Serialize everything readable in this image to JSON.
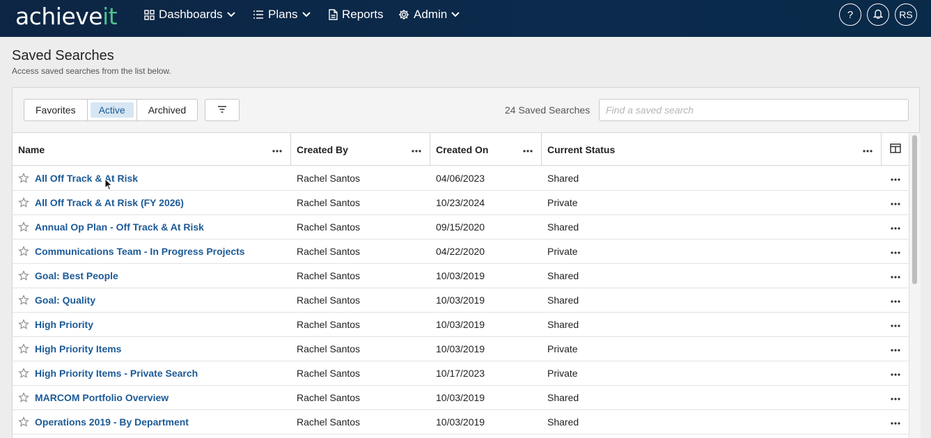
{
  "nav": {
    "logo_main": "achieve",
    "logo_accent": "it",
    "dashboards": "Dashboards",
    "plans": "Plans",
    "reports": "Reports",
    "admin": "Admin",
    "help": "?",
    "avatar_initials": "RS"
  },
  "header": {
    "title": "Saved Searches",
    "subtitle": "Access saved searches from the list below."
  },
  "toolbar": {
    "favorites": "Favorites",
    "active": "Active",
    "archived": "Archived",
    "count": "24 Saved Searches",
    "search_placeholder": "Find a saved search"
  },
  "columns": {
    "name": "Name",
    "created_by": "Created By",
    "created_on": "Created On",
    "status": "Current Status"
  },
  "rows": [
    {
      "name": "All Off Track & At Risk",
      "created_by": "Rachel Santos",
      "created_on": "04/06/2023",
      "status": "Shared"
    },
    {
      "name": "All Off Track & At Risk (FY 2026)",
      "created_by": "Rachel Santos",
      "created_on": "10/23/2024",
      "status": "Private"
    },
    {
      "name": "Annual Op Plan - Off Track & At Risk",
      "created_by": "Rachel Santos",
      "created_on": "09/15/2020",
      "status": "Shared"
    },
    {
      "name": "Communications Team - In Progress Projects",
      "created_by": "Rachel Santos",
      "created_on": "04/22/2020",
      "status": "Private"
    },
    {
      "name": "Goal: Best People",
      "created_by": "Rachel Santos",
      "created_on": "10/03/2019",
      "status": "Shared"
    },
    {
      "name": "Goal: Quality",
      "created_by": "Rachel Santos",
      "created_on": "10/03/2019",
      "status": "Shared"
    },
    {
      "name": "High Priority",
      "created_by": "Rachel Santos",
      "created_on": "10/03/2019",
      "status": "Shared"
    },
    {
      "name": "High Priority Items",
      "created_by": "Rachel Santos",
      "created_on": "10/03/2019",
      "status": "Private"
    },
    {
      "name": "High Priority Items - Private Search",
      "created_by": "Rachel Santos",
      "created_on": "10/17/2023",
      "status": "Private"
    },
    {
      "name": "MARCOM Portfolio Overview",
      "created_by": "Rachel Santos",
      "created_on": "10/03/2019",
      "status": "Shared"
    },
    {
      "name": "Operations 2019 - By Department",
      "created_by": "Rachel Santos",
      "created_on": "10/03/2019",
      "status": "Shared"
    }
  ],
  "colors": {
    "nav_bg": "#0d2544",
    "logo_accent": "#4fc08d",
    "link": "#1c5a96",
    "active_tab_bg": "#d7e6f4"
  }
}
